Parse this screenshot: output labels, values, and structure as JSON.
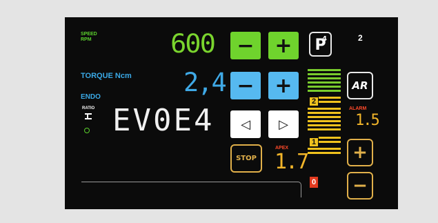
{
  "labels": {
    "speed": "SPEED",
    "rpm": "RPM",
    "torque": "TORQUE Ncm",
    "endo": "ENDO",
    "ratio": "RATIO",
    "alarm": "ALARM",
    "apex": "APEX"
  },
  "speed": {
    "value": "600",
    "minus": "−",
    "plus": "+"
  },
  "torque": {
    "value": "2,4",
    "minus": "−",
    "plus": "+"
  },
  "file_code": "EV0E4",
  "program": {
    "label": "P",
    "index": "4"
  },
  "memory_number": "2",
  "ar_label": "AR",
  "alarm_value": "1.5",
  "apex_value": "1.7",
  "stop_label": "STOP",
  "nav": {
    "left": "◁",
    "right": "▷"
  },
  "scale": {
    "markers": [
      "2",
      "1",
      "0"
    ],
    "green_bars": 6,
    "yellow_bars": 12
  },
  "alarm_plus": "+",
  "alarm_minus": "−",
  "colors": {
    "green": "#6fd32d",
    "blue": "#56b9f0",
    "gold": "#e1b04a",
    "yellow": "#f0c21d",
    "red": "#ff4a2a"
  }
}
